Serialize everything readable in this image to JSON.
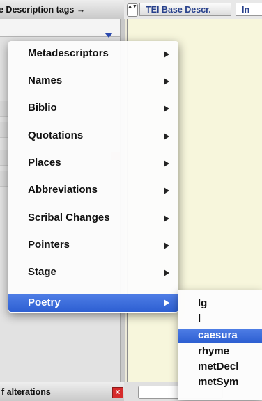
{
  "header": {
    "title": "e Description tags →",
    "tab_stepper": "▲▼",
    "tabs": [
      {
        "label": "TEI Base Descr."
      },
      {
        "label": "In"
      }
    ]
  },
  "bottom_panel": {
    "title": "f alterations",
    "close": "×"
  },
  "menu": {
    "items": [
      {
        "label": "Metadescriptors"
      },
      {
        "label": "Names"
      },
      {
        "label": "Biblio"
      },
      {
        "label": "Quotations"
      },
      {
        "label": "Places"
      },
      {
        "label": "Abbreviations"
      },
      {
        "label": "Scribal Changes"
      },
      {
        "label": "Pointers"
      },
      {
        "label": "Stage"
      },
      {
        "label": "Poetry"
      }
    ],
    "highlighted": "Poetry"
  },
  "submenu": {
    "items": [
      {
        "label": "lg"
      },
      {
        "label": "l"
      },
      {
        "label": "caesura"
      },
      {
        "label": "rhyme"
      },
      {
        "label": "metDecl"
      },
      {
        "label": "metSym"
      }
    ],
    "highlighted": "caesura"
  },
  "colors": {
    "highlight": "#2d5fd2",
    "close_button": "#d62b2b",
    "dropdown_arrow": "#2b4ab0",
    "editor_background": "#f7f6dc"
  }
}
